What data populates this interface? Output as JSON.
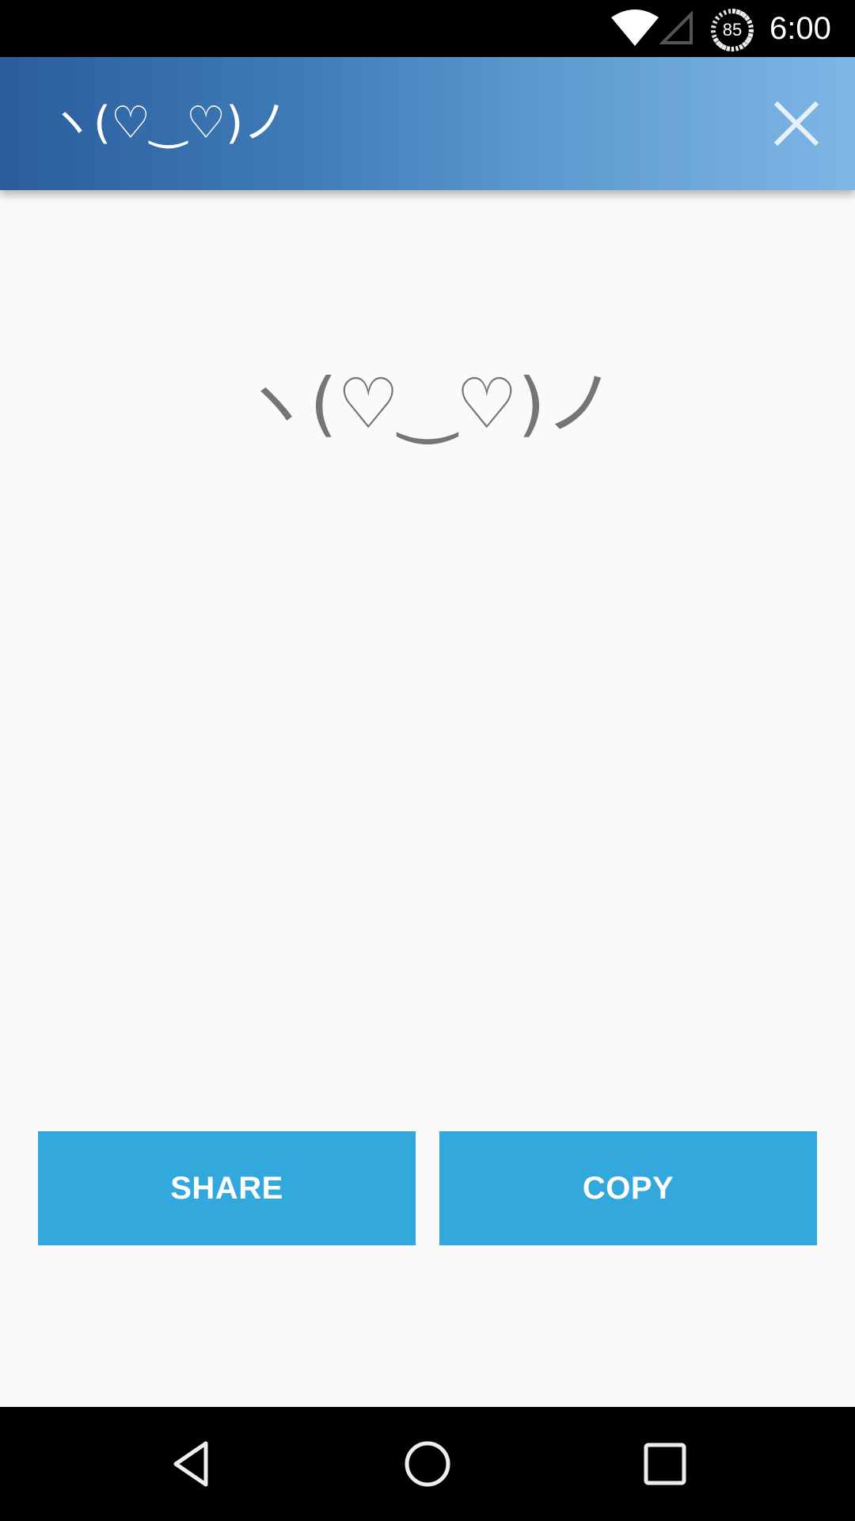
{
  "status_bar": {
    "wifi_icon": "wifi-icon",
    "signal_icon": "cell-signal-empty-icon",
    "battery_level": "85",
    "time": "6:00"
  },
  "app_bar": {
    "title": "ヽ(♡‿♡)ノ",
    "close_icon": "close-icon"
  },
  "content": {
    "kaomoji": "ヽ(♡‿♡)ノ"
  },
  "actions": {
    "share_label": "SHARE",
    "copy_label": "COPY"
  },
  "nav_bar": {
    "back_icon": "back-icon",
    "home_icon": "home-icon",
    "recents_icon": "recents-icon"
  },
  "colors": {
    "app_bar_gradient_start": "#2a5d9e",
    "app_bar_gradient_end": "#7db7e6",
    "button": "#33a8dd",
    "kaomoji_text": "#757575",
    "background": "#fafafa"
  }
}
